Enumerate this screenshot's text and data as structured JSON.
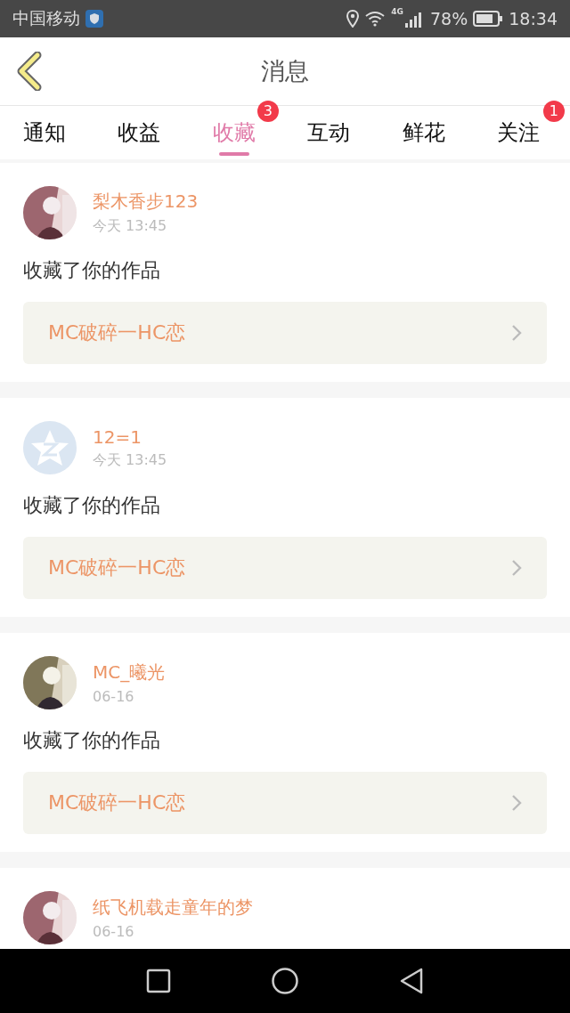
{
  "status_bar": {
    "carrier": "中国移动",
    "network": "4G",
    "battery": "78%",
    "time": "18:34"
  },
  "header": {
    "title": "消息"
  },
  "tabs": [
    {
      "label": "通知",
      "selected": false
    },
    {
      "label": "收益",
      "selected": false
    },
    {
      "label": "收藏",
      "selected": true,
      "badge": "3"
    },
    {
      "label": "互动",
      "selected": false
    },
    {
      "label": "鲜花",
      "selected": false
    },
    {
      "label": "关注",
      "selected": false,
      "badge": "1"
    }
  ],
  "messages": [
    {
      "kind": "picture",
      "name": "梨木香步123",
      "time": "今天 13:45",
      "action": "收藏了你的作品",
      "work": "MC破碎一HC恋"
    },
    {
      "kind": "icon",
      "name": "12=1",
      "time": "今天 13:45",
      "action": "收藏了你的作品",
      "work": "MC破碎一HC恋"
    },
    {
      "kind": "picture",
      "name": "MC_曦光",
      "time": "06-16",
      "action": "收藏了你的作品",
      "work": "MC破碎一HC恋"
    },
    {
      "kind": "picture",
      "name": "纸飞机载走童年的梦",
      "time": "06-16"
    }
  ]
}
